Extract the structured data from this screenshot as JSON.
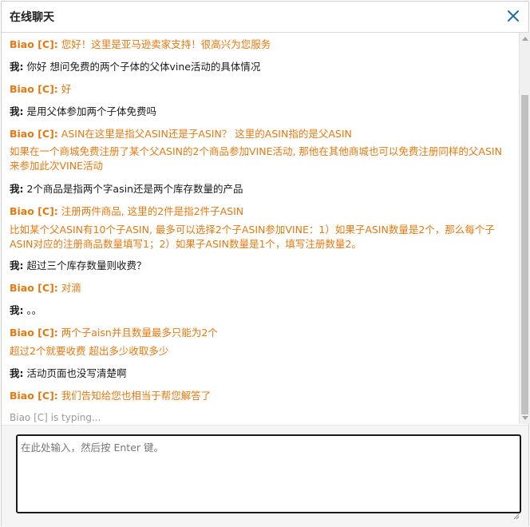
{
  "window": {
    "title": "在线聊天"
  },
  "icons": {
    "close": "close-icon",
    "resize": "resize-grip-icon"
  },
  "colors": {
    "agent": "#e47911",
    "accent": "#1f6fb2"
  },
  "messages": [
    {
      "role": "agent",
      "sender": "Biao [C]:",
      "text": " 您好！这里是亚马逊卖家支持！很高兴为您服务"
    },
    {
      "role": "me",
      "sender": "我:",
      "text": " 你好 想问免费的两个子体的父体vine活动的具体情况"
    },
    {
      "role": "agent",
      "sender": "Biao [C]:",
      "text": " 好"
    },
    {
      "role": "me",
      "sender": "我:",
      "text": " 是用父体参加两个子体免费吗"
    },
    {
      "role": "agent",
      "sender": "Biao [C]:",
      "text": " ASIN在这里是指父ASIN还是子ASIN？ 这里的ASIN指的是父ASIN"
    },
    {
      "role": "agent",
      "sender": "",
      "text": "如果在一个商城免费注册了某个父ASIN的2个商品参加VINE活动, 那他在其他商城也可以免费注册同样的父ASIN来参加此次VINE活动"
    },
    {
      "role": "me",
      "sender": "我:",
      "text": " 2个商品是指两个字asin还是两个库存数量的产品"
    },
    {
      "role": "agent",
      "sender": "Biao [C]:",
      "text": " 注册两件商品, 这里的2件是指2件子ASIN"
    },
    {
      "role": "agent",
      "sender": "",
      "text": "比如某个父ASIN有10个子ASIN, 最多可以选择2个子ASIN参加VINE：1）如果子ASIN数量是2个，那么每个子ASIN对应的注册商品数量填写1；2）如果子ASIN数量是1个，填写注册数量2。"
    },
    {
      "role": "me",
      "sender": "我:",
      "text": " 超过三个库存数量则收费？"
    },
    {
      "role": "agent",
      "sender": "Biao [C]:",
      "text": " 对滴"
    },
    {
      "role": "me",
      "sender": "我:",
      "text": " 。。"
    },
    {
      "role": "agent",
      "sender": "Biao [C]:",
      "text": " 两个子aisn并且数量最多只能为2个"
    },
    {
      "role": "agent",
      "sender": "",
      "text": "超过2个就要收费 超出多少收取多少"
    },
    {
      "role": "me",
      "sender": "我:",
      "text": " 活动页面也没写清楚啊"
    },
    {
      "role": "agent",
      "sender": "Biao [C]:",
      "text": " 我们告知给您也相当于帮您解答了"
    }
  ],
  "typing": "Biao [C] is typing...",
  "composer": {
    "placeholder": "在此处输入，然后按 Enter 键。"
  }
}
